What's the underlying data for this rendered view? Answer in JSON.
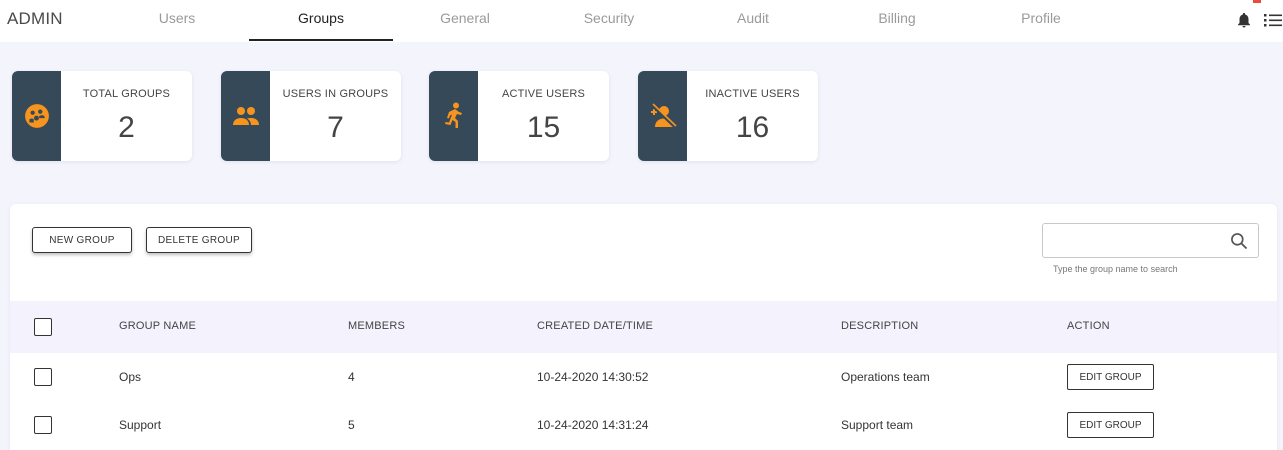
{
  "header": {
    "brand": "ADMIN",
    "tabs": [
      {
        "label": "Users"
      },
      {
        "label": "Groups"
      },
      {
        "label": "General"
      },
      {
        "label": "Security"
      },
      {
        "label": "Audit"
      },
      {
        "label": "Billing"
      },
      {
        "label": "Profile"
      }
    ],
    "active_tab": "Groups"
  },
  "stats": [
    {
      "label": "TOTAL GROUPS",
      "value": "2",
      "icon": "groups-icon"
    },
    {
      "label": "USERS IN GROUPS",
      "value": "7",
      "icon": "people-icon"
    },
    {
      "label": "ACTIVE USERS",
      "value": "15",
      "icon": "running-person-icon"
    },
    {
      "label": "INACTIVE USERS",
      "value": "16",
      "icon": "user-off-icon"
    }
  ],
  "toolbar": {
    "new_group_label": "NEW GROUP",
    "delete_group_label": "DELETE GROUP"
  },
  "search": {
    "value": "",
    "placeholder": "",
    "hint": "Type the group name to search"
  },
  "table": {
    "headers": {
      "name": "GROUP NAME",
      "members": "MEMBERS",
      "created": "CREATED DATE/TIME",
      "description": "DESCRIPTION",
      "action": "ACTION"
    },
    "rows": [
      {
        "name": "Ops",
        "members": "4",
        "created": "10-24-2020 14:30:52",
        "description": "Operations team",
        "action_label": "EDIT GROUP"
      },
      {
        "name": "Support",
        "members": "5",
        "created": "10-24-2020 14:31:24",
        "description": "Support team",
        "action_label": "EDIT GROUP"
      }
    ]
  },
  "colors": {
    "accent_orange": "#f7941d",
    "card_side": "#364958",
    "page_bg": "#f4f4fc",
    "table_header_bg": "#f3f2fd"
  }
}
